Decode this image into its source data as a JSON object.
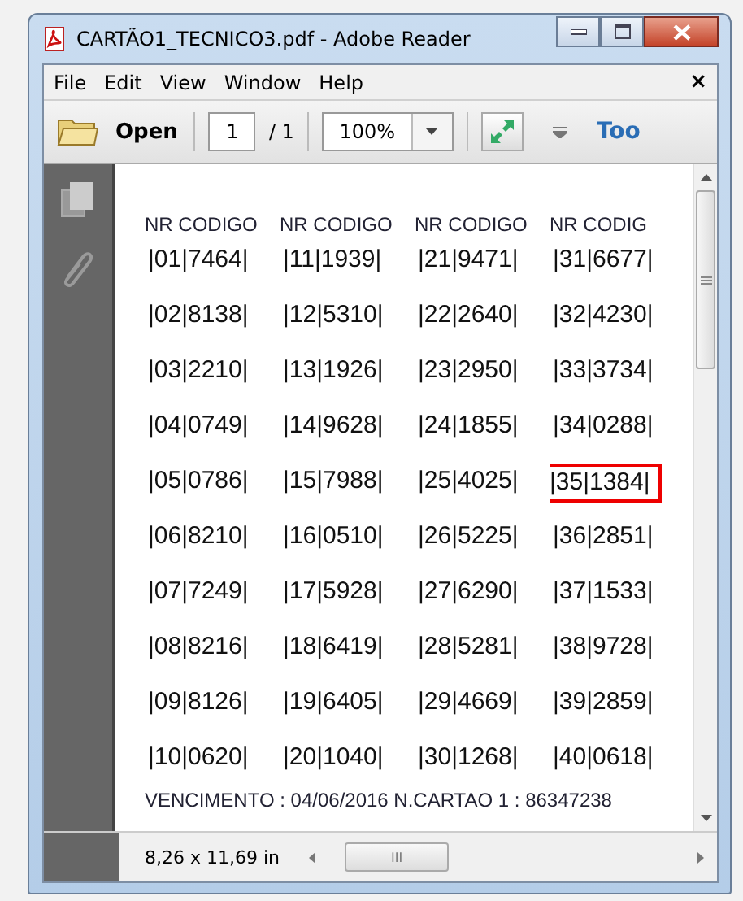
{
  "window": {
    "title": "CARTÃO1_TECNICO3.pdf - Adobe Reader"
  },
  "menu": [
    "File",
    "Edit",
    "View",
    "Window",
    "Help"
  ],
  "menu_close": "×",
  "toolbar": {
    "open": "Open",
    "page": "1",
    "page_total": "/ 1",
    "zoom": "100%",
    "tools": "Too"
  },
  "document": {
    "columns": [
      {
        "header": "NR CODIGO",
        "entries": [
          {
            "text": "|01|7464|",
            "highlighted": false
          },
          {
            "text": "|02|8138|",
            "highlighted": false
          },
          {
            "text": "|03|2210|",
            "highlighted": false
          },
          {
            "text": "|04|0749|",
            "highlighted": false
          },
          {
            "text": "|05|0786|",
            "highlighted": false
          },
          {
            "text": "|06|8210|",
            "highlighted": false
          },
          {
            "text": "|07|7249|",
            "highlighted": false
          },
          {
            "text": "|08|8216|",
            "highlighted": false
          },
          {
            "text": "|09|8126|",
            "highlighted": false
          },
          {
            "text": "|10|0620|",
            "highlighted": false
          }
        ]
      },
      {
        "header": "NR CODIGO",
        "entries": [
          {
            "text": "|11|1939|",
            "highlighted": false
          },
          {
            "text": "|12|5310|",
            "highlighted": false
          },
          {
            "text": "|13|1926|",
            "highlighted": false
          },
          {
            "text": "|14|9628|",
            "highlighted": false
          },
          {
            "text": "|15|7988|",
            "highlighted": false
          },
          {
            "text": "|16|0510|",
            "highlighted": false
          },
          {
            "text": "|17|5928|",
            "highlighted": false
          },
          {
            "text": "|18|6419|",
            "highlighted": false
          },
          {
            "text": "|19|6405|",
            "highlighted": false
          },
          {
            "text": "|20|1040|",
            "highlighted": false
          }
        ]
      },
      {
        "header": "NR CODIGO",
        "entries": [
          {
            "text": "|21|9471|",
            "highlighted": false
          },
          {
            "text": "|22|2640|",
            "highlighted": false
          },
          {
            "text": "|23|2950|",
            "highlighted": false
          },
          {
            "text": "|24|1855|",
            "highlighted": false
          },
          {
            "text": "|25|4025|",
            "highlighted": false
          },
          {
            "text": "|26|5225|",
            "highlighted": false
          },
          {
            "text": "|27|6290|",
            "highlighted": false
          },
          {
            "text": "|28|5281|",
            "highlighted": false
          },
          {
            "text": "|29|4669|",
            "highlighted": false
          },
          {
            "text": "|30|1268|",
            "highlighted": false
          }
        ]
      },
      {
        "header": "NR CODIG",
        "entries": [
          {
            "text": "|31|6677|",
            "highlighted": false
          },
          {
            "text": "|32|4230|",
            "highlighted": false
          },
          {
            "text": "|33|3734|",
            "highlighted": false
          },
          {
            "text": "|34|0288|",
            "highlighted": false
          },
          {
            "text": "|35|1384|",
            "highlighted": true
          },
          {
            "text": "|36|2851|",
            "highlighted": false
          },
          {
            "text": "|37|1533|",
            "highlighted": false
          },
          {
            "text": "|38|9728|",
            "highlighted": false
          },
          {
            "text": "|39|2859|",
            "highlighted": false
          },
          {
            "text": "|40|0618|",
            "highlighted": false
          }
        ]
      }
    ],
    "footer": "VENCIMENTO : 04/06/2016  N.CARTAO 1 :  86347238"
  },
  "status_bar": {
    "page_size": "8,26 x 11,69 in",
    "scroll_grip": "III"
  }
}
